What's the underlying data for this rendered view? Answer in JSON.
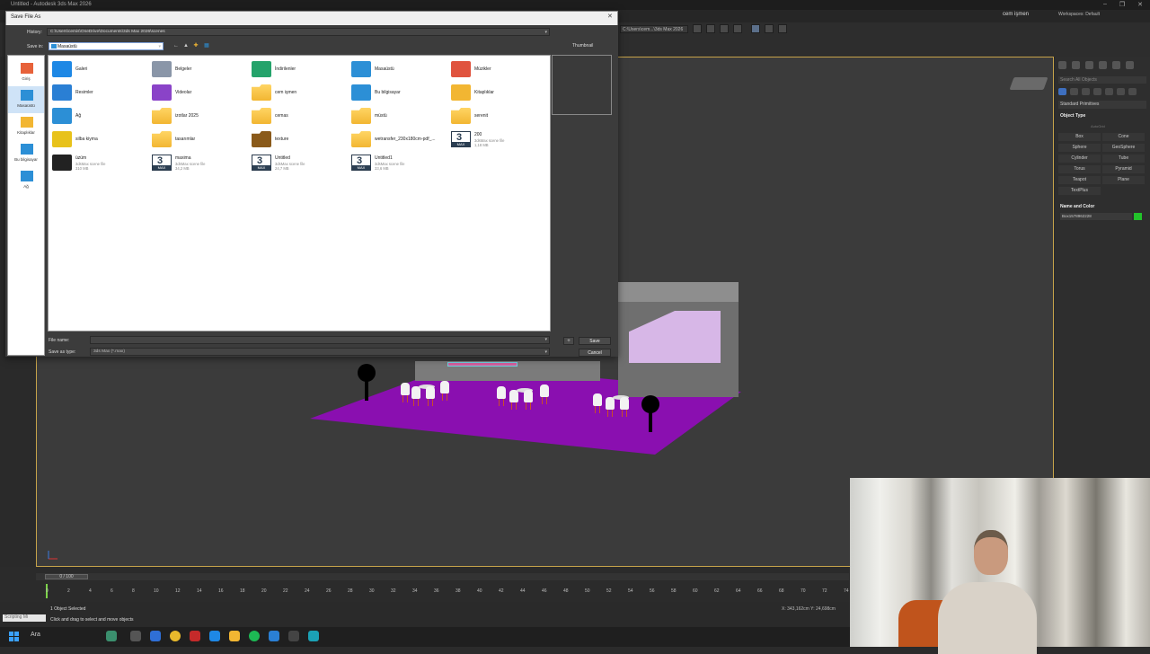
{
  "app": {
    "title": "Untitled - Autodesk 3ds Max 2026",
    "window_controls": [
      "–",
      "❐",
      "✕"
    ],
    "user_name": "cem işmen",
    "workspaces_label": "Workspaces: Default",
    "toolbar_path": "C:\\Users\\cem...\\3ds Max 2026"
  },
  "dialog": {
    "title": "Save File As",
    "close_glyph": "✕",
    "history_label": "History:",
    "history_value": "C:\\Users\\cemis\\OneDrive\\Documents\\3ds Max 2026\\scenes",
    "save_in_label": "Save in:",
    "save_in_value": "Masaüstü",
    "thumbnail_label": "Thumbnail",
    "nav_glyphs": [
      "←",
      "▲",
      "✚",
      "▦"
    ],
    "places": [
      {
        "label": "Giriş",
        "icon": "home-icon",
        "color": "#e7623a"
      },
      {
        "label": "Masaüstü",
        "icon": "desktop-icon",
        "color": "#2c8fd6"
      },
      {
        "label": "Kitaplıklar",
        "icon": "libraries-icon",
        "color": "#f2b632"
      },
      {
        "label": "Bu bilgisayar",
        "icon": "computer-icon",
        "color": "#2c8fd6"
      },
      {
        "label": "Ağ",
        "icon": "network-icon",
        "color": "#2c8fd6"
      }
    ],
    "files": [
      {
        "name": "Galeri",
        "icon": "gallery-icon",
        "color": "#1e88e5"
      },
      {
        "name": "Belgeler",
        "icon": "documents-icon",
        "color": "#8a96a8"
      },
      {
        "name": "İndirilenler",
        "icon": "downloads-icon",
        "color": "#24a36b"
      },
      {
        "name": "Masaüstü",
        "icon": "desktop-icon",
        "color": "#2c8fd6"
      },
      {
        "name": "Müzikler",
        "icon": "music-icon",
        "color": "#e0533e"
      },
      {
        "name": "Resimler",
        "icon": "pictures-icon",
        "color": "#2a7fd4"
      },
      {
        "name": "Videolar",
        "icon": "videos-icon",
        "color": "#8a43c8"
      },
      {
        "name": "cem işmen",
        "icon": "folder-icon",
        "color": "#f2b632"
      },
      {
        "name": "Bu bilgisayar",
        "icon": "computer-icon",
        "color": "#2c8fd6"
      },
      {
        "name": "Kitaplıklar",
        "icon": "libraries-icon",
        "color": "#f2b632"
      },
      {
        "name": "Ağ",
        "icon": "network-icon",
        "color": "#2c8fd6"
      },
      {
        "name": "izotlar 2025",
        "icon": "folder-icon",
        "color": "#f2b632"
      },
      {
        "name": "cemas",
        "icon": "folder-icon",
        "color": "#f2b632"
      },
      {
        "name": "müstü",
        "icon": "folder-icon",
        "color": "#f2b632"
      },
      {
        "name": "serenit",
        "icon": "folder-icon",
        "color": "#f2b632"
      },
      {
        "name": "silba kiyma",
        "icon": "image-file-icon",
        "color": "#e8c21a"
      },
      {
        "name": "tasarımlar",
        "icon": "folder-icon",
        "color": "#f2b632"
      },
      {
        "name": "texture",
        "icon": "folder-icon",
        "color": "#8a5a1a"
      },
      {
        "name": "wetransfer_230x180cm-pdf_...",
        "icon": "folder-icon",
        "color": "#f2b632"
      },
      {
        "name": "200",
        "sub": "3dsMax scene file",
        "size": "1,18 MB",
        "icon": "max-file-icon",
        "color": "#2b3e52"
      },
      {
        "name": "üzüm",
        "sub": "3dsMax scene file",
        "size": "310 MB",
        "icon": "image-file-icon",
        "color": "#222"
      },
      {
        "name": "maxima",
        "sub": "3dsMax scene file",
        "size": "34,2 MB",
        "icon": "max-file-icon",
        "color": "#2b3e52"
      },
      {
        "name": "Untitled",
        "sub": "3dsMax scene file",
        "size": "24,7 MB",
        "icon": "max-file-icon",
        "color": "#2b3e52"
      },
      {
        "name": "Untitled1",
        "sub": "3dsMax scene file",
        "size": "33,6 MB",
        "icon": "max-file-icon",
        "color": "#2b3e52"
      }
    ],
    "file_name_label": "File name:",
    "file_name_value": "",
    "save_as_type_label": "Save as type:",
    "save_as_type_value": "3ds Max (*.max)",
    "plus_label": "+",
    "save_label": "Save",
    "cancel_label": "Cancel",
    "dropdown_glyph": "▾"
  },
  "command_panel": {
    "search_placeholder": "Search All Objects",
    "category": "Standard Primitives",
    "object_type_title": "Object Type",
    "autogrid": "AutoGrid",
    "primitives": [
      "Box",
      "Cone",
      "Sphere",
      "GeoSphere",
      "Cylinder",
      "Tube",
      "Torus",
      "Pyramid",
      "Teapot",
      "Plane",
      "TextPlus",
      ""
    ],
    "name_color_title": "Name and Color",
    "object_name": "Box1578962228",
    "object_color": "#22c22a"
  },
  "timeline": {
    "frame_counter": "0 / 100",
    "ticks": [
      "0",
      "2",
      "4",
      "6",
      "8",
      "10",
      "12",
      "14",
      "16",
      "18",
      "20",
      "22",
      "24",
      "26",
      "28",
      "30",
      "32",
      "34",
      "36",
      "38",
      "40",
      "42",
      "44",
      "46",
      "48",
      "50",
      "52",
      "54",
      "56",
      "58",
      "60",
      "62",
      "64",
      "66",
      "68",
      "70",
      "72",
      "74"
    ]
  },
  "status": {
    "selected": "1 Object Selected",
    "hint": "Click and drag to select and move objects",
    "maxscript": "Scripting Mi",
    "coords": "X: 343,162cm  Y: 24,698cm"
  },
  "taskbar": {
    "search_label": "Ara"
  }
}
